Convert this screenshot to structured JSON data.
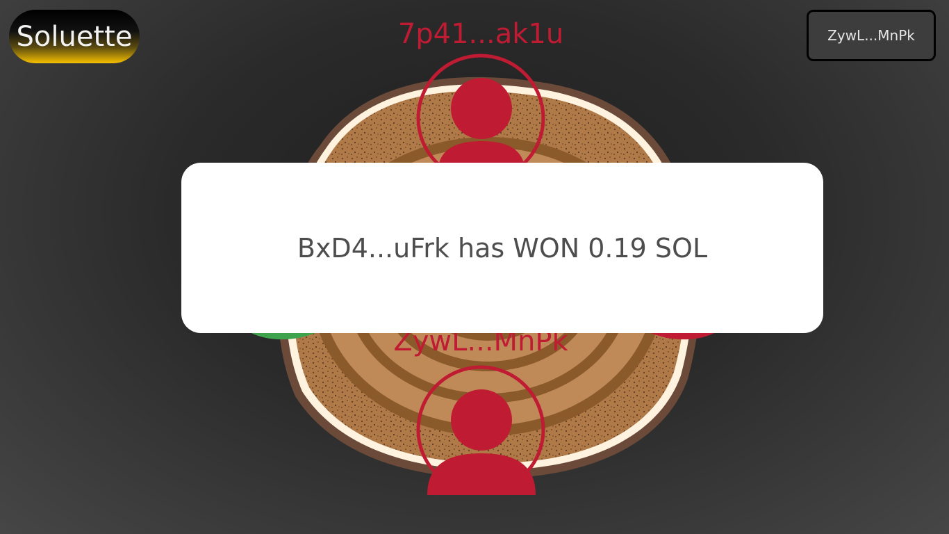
{
  "app": {
    "logo_text": "Soluette"
  },
  "header": {
    "wallet_label": "ZywL...MnPk"
  },
  "players": {
    "top": {
      "name": "7p41...ak1u",
      "color": "#bf1b32"
    },
    "bottom": {
      "name": "ZywL...MnPk",
      "color": "#bf1b32"
    },
    "left": {
      "color": "#3fa34d"
    },
    "right": {
      "color": "#bf1b32"
    }
  },
  "result_modal": {
    "message": "BxD4...uFrk has WON 0.19 SOL"
  },
  "colors": {
    "accent_red": "#bf1b32",
    "accent_green": "#3fa34d",
    "logo_gold": "#f6c000",
    "table_wood": "#b5814f",
    "table_ring": "#8b5a2b"
  }
}
